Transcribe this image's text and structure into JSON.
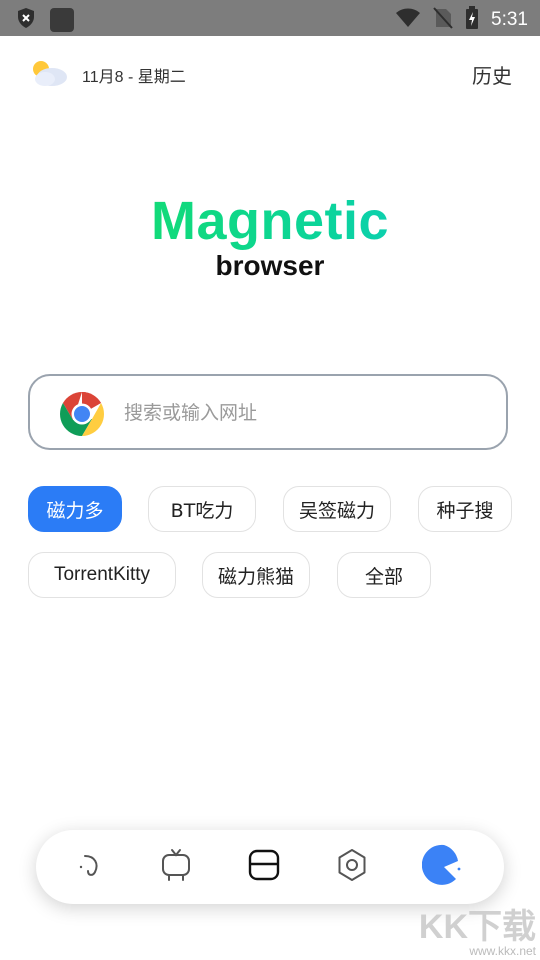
{
  "status_bar": {
    "time": "5:31",
    "icons": [
      "shield-icon",
      "app-icon",
      "wifi-icon",
      "no-sim-icon",
      "battery-icon"
    ]
  },
  "header": {
    "weather_icon": "partly-cloudy-icon",
    "date": "11月8 - 星期二",
    "history_label": "历史"
  },
  "logo": {
    "title": "Magnetic",
    "subtitle": "browser",
    "title_gradient": [
      "#18e05b",
      "#11c7dc"
    ]
  },
  "search": {
    "icon": "chrome-icon",
    "placeholder": "搜索或输入网址"
  },
  "engines": {
    "accent": "#2b7cf6",
    "items": [
      {
        "label": "磁力多",
        "active": true
      },
      {
        "label": "BT吃力",
        "active": false
      },
      {
        "label": "吴签磁力",
        "active": false
      },
      {
        "label": "种子搜",
        "active": false
      },
      {
        "label": "TorrentKitty",
        "active": false
      },
      {
        "label": "磁力熊猫",
        "active": false
      },
      {
        "label": "全部",
        "active": false
      }
    ]
  },
  "bottom_nav": {
    "items": [
      "hook-icon",
      "tv-icon",
      "tabs-icon",
      "settings-icon",
      "pacman-icon"
    ]
  },
  "watermark": {
    "main": "KK下载",
    "url": "www.kkx.net"
  }
}
